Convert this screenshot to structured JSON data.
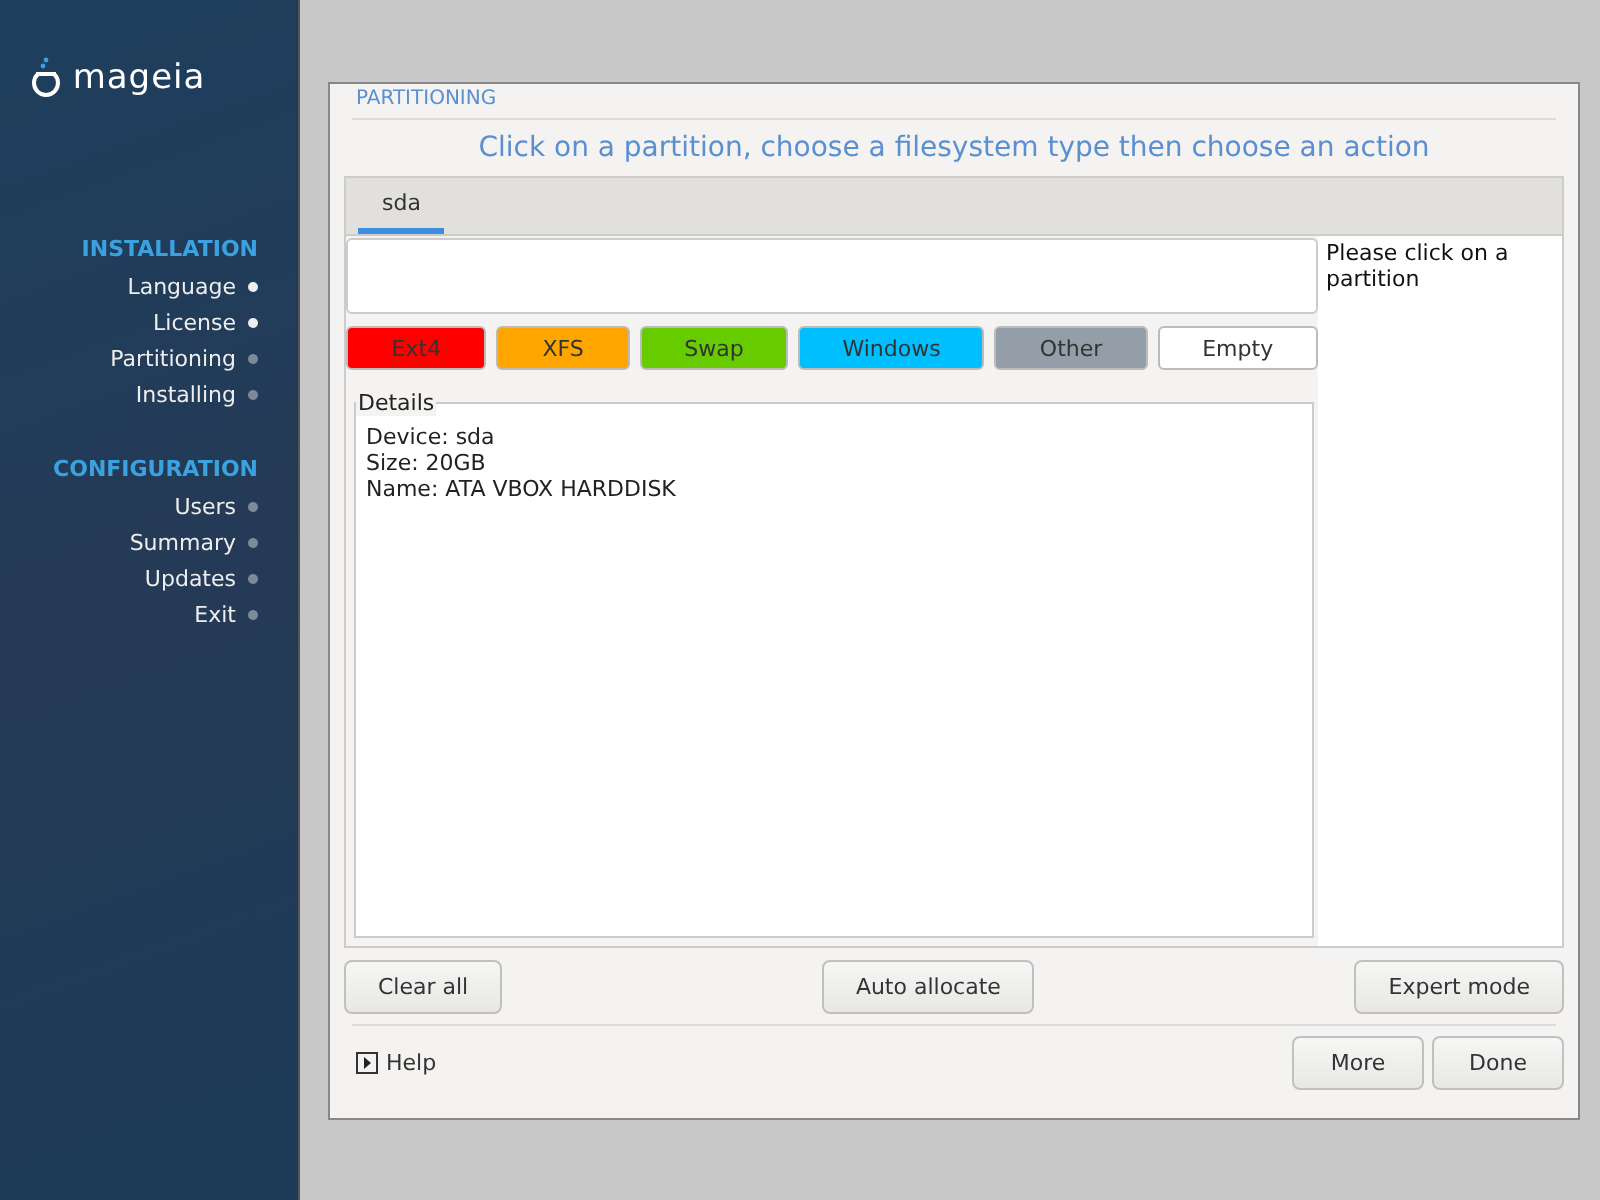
{
  "sidebar": {
    "logo_text": "mageia",
    "sections": [
      {
        "title": "INSTALLATION",
        "steps": [
          {
            "label": "Language",
            "done": true
          },
          {
            "label": "License",
            "done": true
          },
          {
            "label": "Partitioning",
            "done": false
          },
          {
            "label": "Installing",
            "done": false
          }
        ]
      },
      {
        "title": "CONFIGURATION",
        "steps": [
          {
            "label": "Users",
            "done": false
          },
          {
            "label": "Summary",
            "done": false
          },
          {
            "label": "Updates",
            "done": false
          },
          {
            "label": "Exit",
            "done": false
          }
        ]
      }
    ]
  },
  "window": {
    "title": "PARTITIONING",
    "heading": "Click on a partition, choose a filesystem type then choose an action",
    "tabs": [
      {
        "label": "sda",
        "selected": true
      }
    ],
    "legend": [
      {
        "label": "Ext4",
        "color": "#ff0000"
      },
      {
        "label": "XFS",
        "color": "#ffa500"
      },
      {
        "label": "Swap",
        "color": "#66cc00"
      },
      {
        "label": "Windows",
        "color": "#00bfff"
      },
      {
        "label": "Other",
        "color": "#939ea9"
      },
      {
        "label": "Empty",
        "color": "#ffffff"
      }
    ],
    "details": {
      "title": "Details",
      "lines": [
        "Device: sda",
        "Size: 20GB",
        "Name: ATA VBOX HARDDISK"
      ]
    },
    "hint": "Please click on a partition",
    "actions": [
      "Clear all",
      "Auto allocate",
      "Expert mode"
    ],
    "help": "Help",
    "buttons": [
      "More",
      "Done"
    ]
  }
}
